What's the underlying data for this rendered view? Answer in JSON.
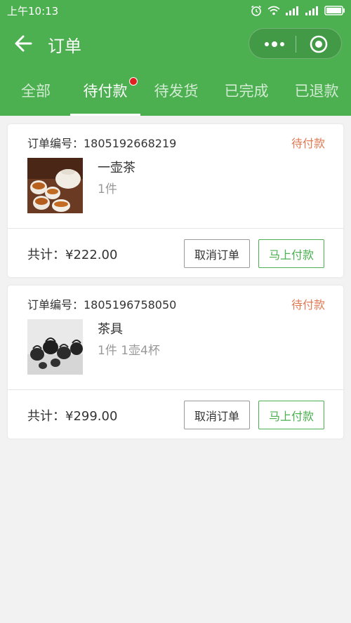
{
  "status_bar": {
    "time": "上午10:13"
  },
  "nav": {
    "title": "订单"
  },
  "tabs": [
    {
      "label": "全部"
    },
    {
      "label": "待付款"
    },
    {
      "label": "待发货"
    },
    {
      "label": "已完成"
    },
    {
      "label": "已退款"
    }
  ],
  "orders": [
    {
      "order_number_label": "订单编号：1805192668219",
      "status": "待付款",
      "product_name": "一壶茶",
      "product_desc": "1件",
      "total": "共计：¥222.00",
      "cancel_label": "取消订单",
      "pay_label": "马上付款"
    },
    {
      "order_number_label": "订单编号：1805196758050",
      "status": "待付款",
      "product_name": "茶具",
      "product_desc": "1件 1壶4杯",
      "total": "共计：¥299.00",
      "cancel_label": "取消订单",
      "pay_label": "马上付款"
    }
  ],
  "colors": {
    "brand": "#4caf50",
    "status": "#e07b55",
    "badge": "#e02020"
  }
}
